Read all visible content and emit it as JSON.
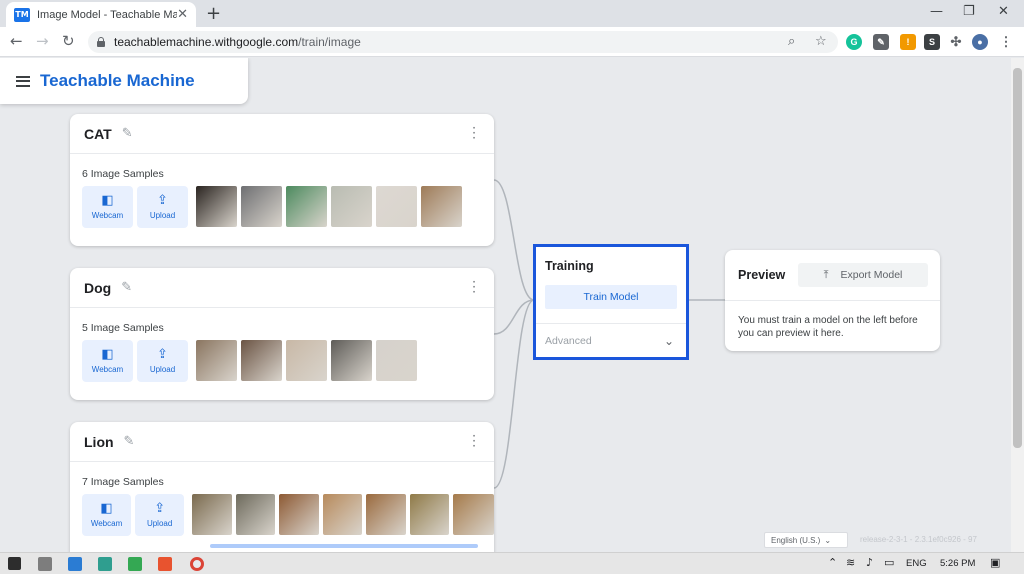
{
  "browser": {
    "tab_title": "Image Model - Teachable Machine",
    "favicon_text": "TM",
    "url_host": "teachablemachine.withgoogle.com",
    "url_path": "/train/image"
  },
  "app": {
    "title": "Teachable Machine"
  },
  "classes": [
    {
      "name": "CAT",
      "samples_label": "6 Image Samples",
      "thumb_colors": [
        "#2a2420",
        "#6e6f72",
        "#4c8a5e",
        "#b9bcb2",
        "#ddd8d2",
        "#9e7b58"
      ]
    },
    {
      "name": "Dog",
      "samples_label": "5 Image Samples",
      "thumb_colors": [
        "#8a7560",
        "#6b5444",
        "#c8b8a6",
        "#5e5c58",
        "#d6d2cc"
      ]
    },
    {
      "name": "Lion",
      "samples_label": "7 Image Samples",
      "thumb_colors": [
        "#7a6a4e",
        "#6d6a5c",
        "#8d5a34",
        "#b78a5c",
        "#9a6a3e",
        "#8f7a48",
        "#a57a4a"
      ]
    }
  ],
  "buttons": {
    "webcam": "Webcam",
    "upload": "Upload"
  },
  "training": {
    "title": "Training",
    "train_button": "Train Model",
    "advanced_label": "Advanced"
  },
  "preview": {
    "title": "Preview",
    "export_button": "Export Model",
    "message": "You must train a model on the left before you can preview it here."
  },
  "footer": {
    "language": "English (U.S.)",
    "release": "release-2-3-1 - 2.3.1ef0c926 - 97"
  },
  "taskbar": {
    "language": "ENG",
    "time": "5:26 PM"
  },
  "colors": {
    "brand": "#1967d2",
    "training_border": "#1a56db",
    "button_bg": "#e8f0fe"
  }
}
